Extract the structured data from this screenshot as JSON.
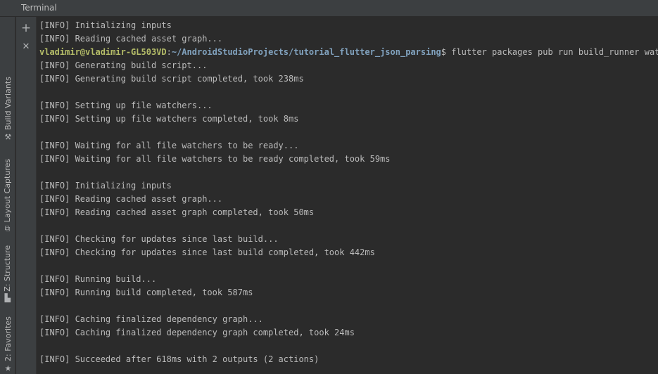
{
  "window": {
    "title": "Terminal"
  },
  "side_tabs": [
    {
      "label": "Build Variants",
      "icon": "build-variants-icon",
      "glyph": "⚒"
    },
    {
      "label": "Layout Captures",
      "icon": "layout-captures-icon",
      "glyph": "⧉"
    },
    {
      "label": "Z: Structure",
      "icon": "structure-icon",
      "glyph": "▙"
    },
    {
      "label": "2: Favorites",
      "icon": "star-icon",
      "glyph": "★"
    }
  ],
  "toolbar": {
    "add_glyph": "+",
    "close_glyph": "✕"
  },
  "prompt": {
    "user_host": "vladimir@vladimir-GL503VD",
    "separator": ":",
    "path": "~/AndroidStudioProjects/tutorial_flutter_json_parsing",
    "symbol": "$",
    "command": " flutter packages pub run build_runner watch"
  },
  "lines_before": [
    "[INFO] Initializing inputs",
    "[INFO] Reading cached asset graph..."
  ],
  "lines_after": [
    "[INFO] Generating build script...",
    "[INFO] Generating build script completed, took 238ms",
    "",
    "[INFO] Setting up file watchers...",
    "[INFO] Setting up file watchers completed, took 8ms",
    "",
    "[INFO] Waiting for all file watchers to be ready...",
    "[INFO] Waiting for all file watchers to be ready completed, took 59ms",
    "",
    "[INFO] Initializing inputs",
    "[INFO] Reading cached asset graph...",
    "[INFO] Reading cached asset graph completed, took 50ms",
    "",
    "[INFO] Checking for updates since last build...",
    "[INFO] Checking for updates since last build completed, took 442ms",
    "",
    "[INFO] Running build...",
    "[INFO] Running build completed, took 587ms",
    "",
    "[INFO] Caching finalized dependency graph...",
    "[INFO] Caching finalized dependency graph completed, took 24ms",
    "",
    "[INFO] Succeeded after 618ms with 2 outputs (2 actions)"
  ]
}
